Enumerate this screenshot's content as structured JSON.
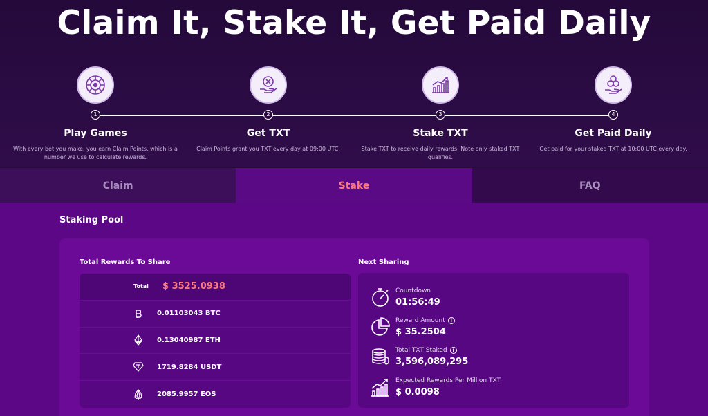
{
  "title": "Claim It, Stake It, Get Paid Daily",
  "steps": [
    {
      "num": "1",
      "title": "Play Games",
      "desc": "With every bet you make, you earn Claim Points, which is a number we use to calculate rewards.",
      "icon": "roulette-icon"
    },
    {
      "num": "2",
      "title": "Get TXT",
      "desc": "Claim Points grant you TXT every day at 09:00 UTC.",
      "icon": "hand-coin-icon"
    },
    {
      "num": "3",
      "title": "Stake TXT",
      "desc": "Stake TXT to receive daily rewards. Note only staked TXT qualifies.",
      "icon": "growth-chart-icon"
    },
    {
      "num": "4",
      "title": "Get Paid Daily",
      "desc": "Get paid for your staked TXT at 10:00 UTC every day.",
      "icon": "hand-coins-icon"
    }
  ],
  "tabs": [
    {
      "label": "Claim",
      "active": false
    },
    {
      "label": "Stake",
      "active": true
    },
    {
      "label": "FAQ",
      "active": false
    }
  ],
  "pool": {
    "title": "Staking Pool",
    "rewards_label": "Total Rewards To Share",
    "total_label": "Total",
    "total_value": "$ 3525.0938",
    "rows": [
      {
        "icon": "bitcoin-icon",
        "amount": "0.01103043",
        "unit": "BTC"
      },
      {
        "icon": "ethereum-icon",
        "amount": "0.13040987",
        "unit": "ETH"
      },
      {
        "icon": "tether-icon",
        "amount": "1719.8284",
        "unit": "USDT"
      },
      {
        "icon": "eos-icon",
        "amount": "2085.9957",
        "unit": "EOS"
      }
    ],
    "sharing_label": "Next Sharing",
    "sharing": [
      {
        "icon": "stopwatch-icon",
        "label": "Countdown",
        "value": "01:56:49",
        "info": false
      },
      {
        "icon": "pie-chart-icon",
        "label": "Reward Amount",
        "value": "$ 35.2504",
        "info": true
      },
      {
        "icon": "coin-stack-icon",
        "label": "Total TXT Staked",
        "value": "3,596,089,295",
        "info": true
      },
      {
        "icon": "rising-chart-icon",
        "label": "Expected Rewards Per Million TXT",
        "value": "$ 0.0098",
        "info": false
      }
    ]
  },
  "colors": {
    "accent": "#ff7a7a",
    "panel": "#5c0786",
    "hero": "#2a0b3d"
  }
}
